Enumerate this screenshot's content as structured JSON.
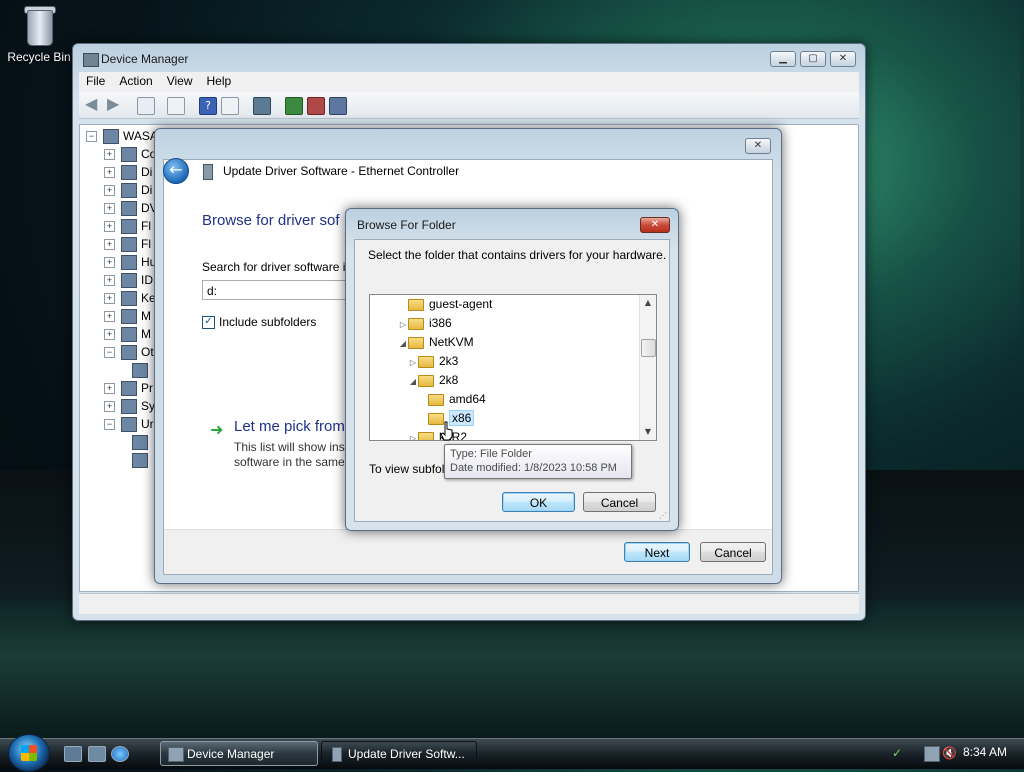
{
  "desktop": {
    "recycle_bin_label": "Recycle Bin"
  },
  "device_manager": {
    "title": "Device Manager",
    "menu": [
      "File",
      "Action",
      "View",
      "Help"
    ],
    "tree": [
      {
        "exp": "−",
        "text": "WASA"
      },
      {
        "exp": "+",
        "text": "Co"
      },
      {
        "exp": "+",
        "text": "Di"
      },
      {
        "exp": "+",
        "text": "Di"
      },
      {
        "exp": "+",
        "text": "DV"
      },
      {
        "exp": "+",
        "text": "Fl"
      },
      {
        "exp": "+",
        "text": "Fl"
      },
      {
        "exp": "+",
        "text": "Hu"
      },
      {
        "exp": "+",
        "text": "ID"
      },
      {
        "exp": "+",
        "text": "Ke"
      },
      {
        "exp": "+",
        "text": "M"
      },
      {
        "exp": "+",
        "text": "M"
      },
      {
        "exp": "−",
        "text": "Ot"
      },
      {
        "exp": "",
        "text": ""
      },
      {
        "exp": "+",
        "text": "Pr"
      },
      {
        "exp": "+",
        "text": "Sy"
      },
      {
        "exp": "−",
        "text": "Ur"
      },
      {
        "exp": "",
        "text": ""
      },
      {
        "exp": "",
        "text": ""
      }
    ]
  },
  "update_driver": {
    "title": "Update Driver Software - Ethernet Controller",
    "heading": "Browse for driver sof",
    "search_label": "Search for driver software in",
    "path_value": "d:",
    "include_subfolders": "Include subfolders",
    "pick_title": "Let me pick from",
    "pick_desc": "This list will show inst software in the same",
    "next_label": "Next",
    "cancel_label": "Cancel"
  },
  "browse_folder": {
    "title": "Browse For Folder",
    "description": "Select the folder that contains drivers for your hardware.",
    "folders": [
      {
        "indent": 0,
        "arrow": "",
        "name": "guest-agent"
      },
      {
        "indent": 0,
        "arrow": "▷",
        "name": "i386"
      },
      {
        "indent": 0,
        "arrow": "◢",
        "name": "NetKVM"
      },
      {
        "indent": 1,
        "arrow": "▷",
        "name": "2k3"
      },
      {
        "indent": 1,
        "arrow": "◢",
        "name": "2k8"
      },
      {
        "indent": 2,
        "arrow": "",
        "name": "amd64"
      },
      {
        "indent": 2,
        "arrow": "",
        "name": "x86",
        "selected": true
      },
      {
        "indent": 1,
        "arrow": "▷",
        "name": "k8R2"
      }
    ],
    "view_subfolders_text": "To view subfold",
    "ok_label": "OK",
    "cancel_label": "Cancel"
  },
  "tooltip": {
    "type_line": "Type: File Folder",
    "modified_line": "Date modified: 1/8/2023 10:58 PM"
  },
  "taskbar": {
    "tasks": [
      {
        "label": "Device Manager"
      },
      {
        "label": "Update Driver Softw..."
      }
    ],
    "clock": "8:34 AM"
  },
  "colors": {
    "link_blue": "#1e3287",
    "selection": "#cce8ff",
    "close_red": "#c94b38"
  }
}
